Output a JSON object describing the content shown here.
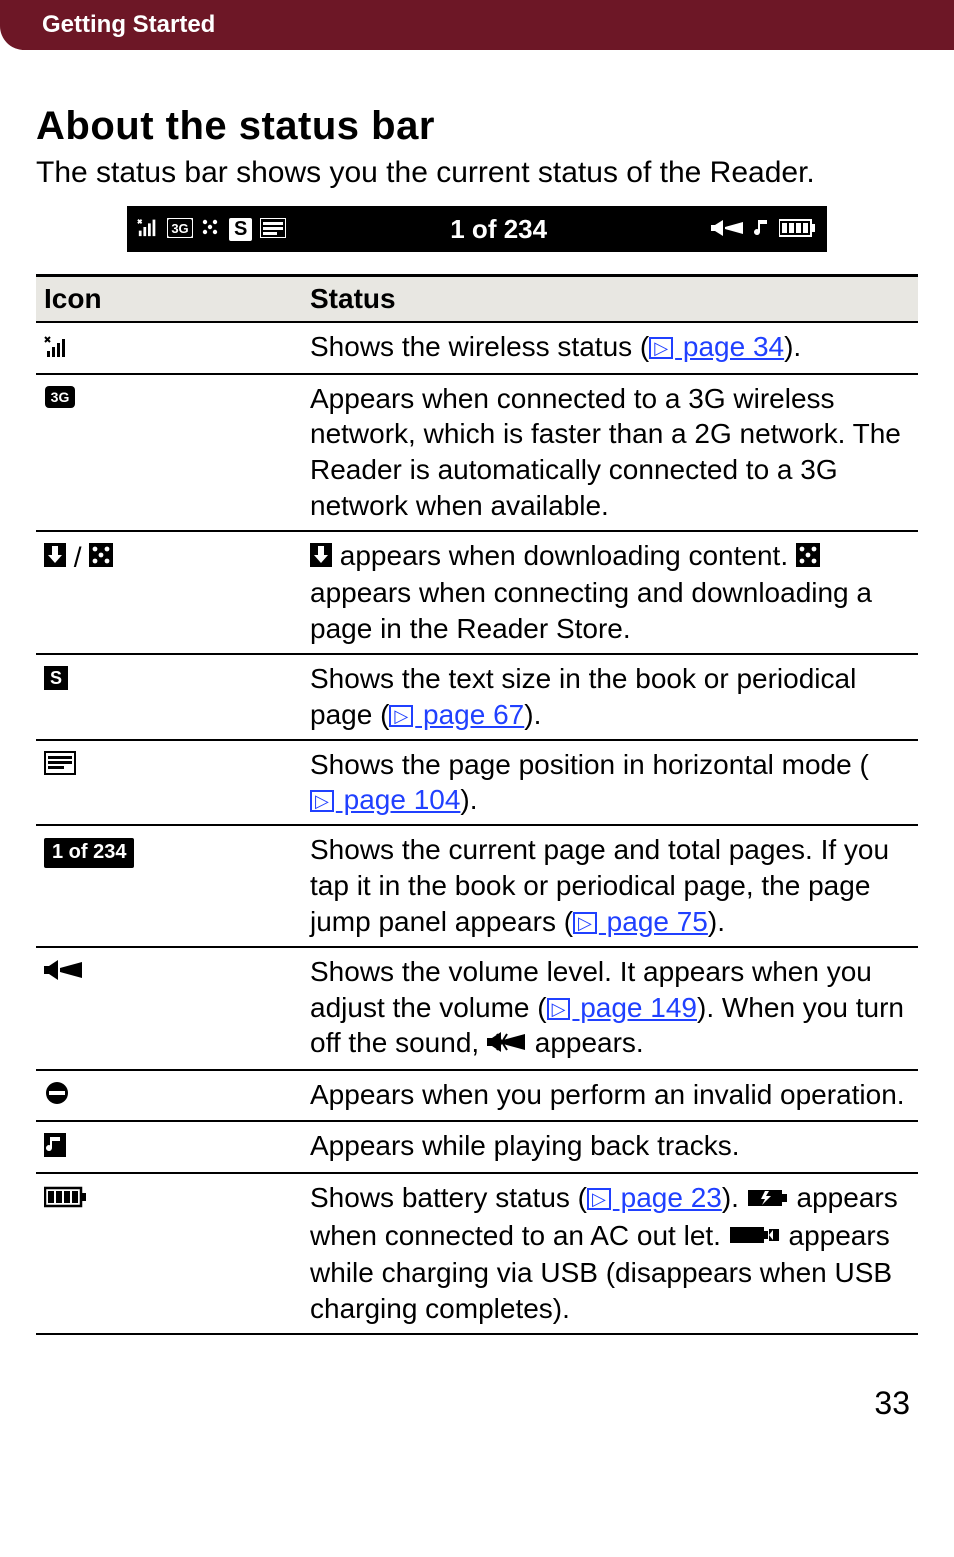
{
  "header": {
    "tab": "Getting Started"
  },
  "title": "About the status bar",
  "intro": "The status bar shows you the current status of the Reader.",
  "status_illustration": {
    "center_text": "1 of 234",
    "left_text_size_letter": "S",
    "left_3g_label": "3G"
  },
  "table": {
    "headers": {
      "icon": "Icon",
      "status": "Status"
    },
    "rows": [
      {
        "icon_name": "wireless-signal-icon",
        "status_parts": [
          {
            "t": "Shows the wireless status ("
          },
          {
            "ref": "page 34"
          },
          {
            "t": ")."
          }
        ]
      },
      {
        "icon_name": "3g-network-icon",
        "status_parts": [
          {
            "t": "Appears when connected to a 3G wireless network, which is faster than a 2G network. The Reader is automatically connected to a 3G network when available."
          }
        ]
      },
      {
        "icon_name": "download-icons",
        "status_parts": [
          {
            "inline_icon": "download-arrow-icon"
          },
          {
            "t": " appears when downloading content. "
          },
          {
            "inline_icon": "download-dots-icon"
          },
          {
            "t": " appears when connecting and downloading a page in the Reader Store."
          }
        ]
      },
      {
        "icon_name": "text-size-icon",
        "status_parts": [
          {
            "t": "Shows the text size in the book or periodical page ("
          },
          {
            "ref": "page 67"
          },
          {
            "t": ")."
          }
        ]
      },
      {
        "icon_name": "page-position-icon",
        "status_parts": [
          {
            "t": "Shows the page position in horizontal mode ("
          },
          {
            "ref": "page 104"
          },
          {
            "t": ")."
          }
        ]
      },
      {
        "icon_name": "page-indicator-pill",
        "icon_text": "1 of 234",
        "status_parts": [
          {
            "t": "Shows the current page and total pages. If you tap it in the book or periodical page, the page jump panel appears ("
          },
          {
            "ref": "page 75"
          },
          {
            "t": ")."
          }
        ]
      },
      {
        "icon_name": "volume-icon",
        "status_parts": [
          {
            "t": "Shows the volume level. It appears when you adjust the volume ("
          },
          {
            "ref": "page 149"
          },
          {
            "t": "). When you turn off the sound, "
          },
          {
            "inline_icon": "mute-icon"
          },
          {
            "t": " appears."
          }
        ]
      },
      {
        "icon_name": "invalid-operation-icon",
        "status_parts": [
          {
            "t": "Appears when you perform an invalid operation."
          }
        ]
      },
      {
        "icon_name": "music-note-icon",
        "status_parts": [
          {
            "t": "Appears while playing back tracks."
          }
        ]
      },
      {
        "icon_name": "battery-icon",
        "status_parts": [
          {
            "t": "Shows battery status ("
          },
          {
            "ref": "page 23"
          },
          {
            "t": "). "
          },
          {
            "inline_icon": "battery-ac-icon"
          },
          {
            "t": " appears when connected to an AC out let. "
          },
          {
            "inline_icon": "battery-usb-icon"
          },
          {
            "t": " appears while charging via USB (disappears when USB charging completes)."
          }
        ]
      }
    ]
  },
  "page_number": "33"
}
